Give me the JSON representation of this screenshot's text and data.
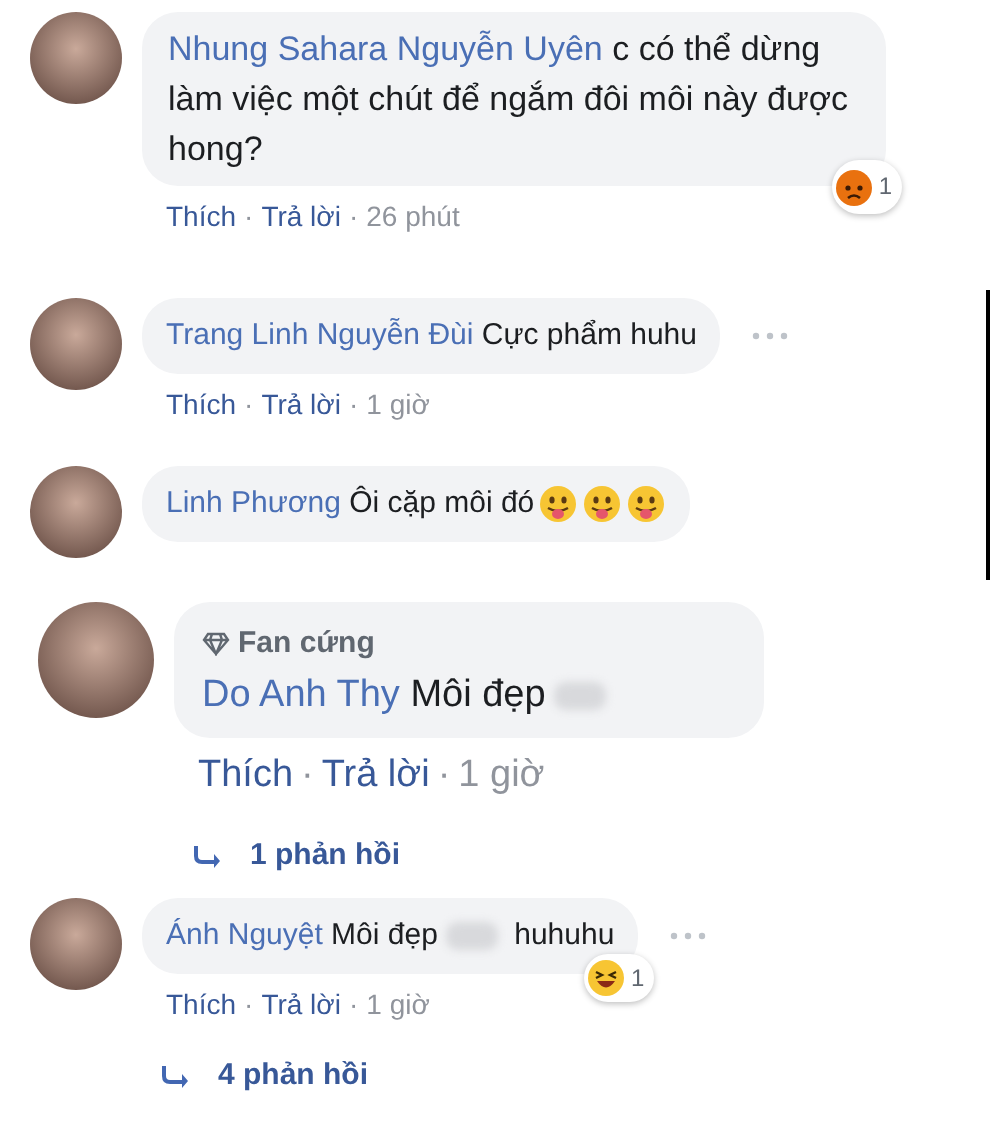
{
  "separator": "·",
  "comments": [
    {
      "name": "Nhung Sahara Nguyễn Uyên",
      "segments": [
        {
          "kind": "text",
          "text": "c có thể dừng làm việc một chút để ngắm đôi môi này được hong?"
        }
      ],
      "actions": [
        "Thích",
        "Trả lời",
        "26 phút"
      ],
      "reaction": {
        "kind": "angry",
        "count": "1"
      }
    },
    {
      "name": "Trang Linh Nguyễn Đùi",
      "segments": [
        {
          "kind": "text",
          "text": "Cực phẩm huhu"
        }
      ],
      "actions": [
        "Thích",
        "Trả lời",
        "1 giờ"
      ],
      "more": true
    },
    {
      "name": "Linh Phương",
      "segments": [
        {
          "kind": "text",
          "text": "Ôi cặp môi đó"
        },
        {
          "kind": "emoji"
        },
        {
          "kind": "emoji"
        },
        {
          "kind": "emoji"
        }
      ]
    },
    {
      "badge": "Fan cứng",
      "name": "Do Anh Thy",
      "segments": [
        {
          "kind": "text",
          "text": "Môi đẹp"
        },
        {
          "kind": "censored"
        }
      ],
      "actions": [
        "Thích",
        "Trả lời",
        "1 giờ"
      ],
      "replies": "1 phản hồi"
    },
    {
      "name": "Ánh Nguyệt",
      "segments": [
        {
          "kind": "text",
          "text": "Môi đẹp"
        },
        {
          "kind": "censored"
        },
        {
          "kind": "text",
          "text": "huhuhu"
        }
      ],
      "actions": [
        "Thích",
        "Trả lời",
        "1 giờ"
      ],
      "reaction": {
        "kind": "laugh",
        "count": "1"
      },
      "replies": "4 phản hồi",
      "more": true
    }
  ]
}
